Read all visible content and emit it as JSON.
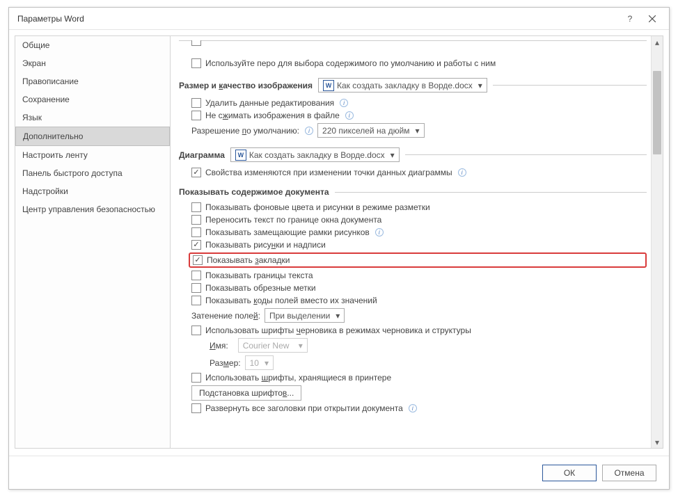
{
  "dialog": {
    "title": "Параметры Word"
  },
  "sidebar": {
    "items": [
      {
        "label": "Общие"
      },
      {
        "label": "Экран"
      },
      {
        "label": "Правописание"
      },
      {
        "label": "Сохранение"
      },
      {
        "label": "Язык"
      },
      {
        "label": "Дополнительно",
        "selected": true
      },
      {
        "label": "Настроить ленту"
      },
      {
        "label": "Панель быстрого доступа"
      },
      {
        "label": "Надстройки"
      },
      {
        "label": "Центр управления безопасностью"
      }
    ]
  },
  "top": {
    "pen_default": "Используйте перо для выбора содержимого по умолчанию и работы с ним"
  },
  "image_section": {
    "title_pre": "Размер и ",
    "title_u": "к",
    "title_post": "ачество изображения",
    "doc_dropdown": "Как создать закладку в Ворде.docx",
    "delete_edit": "Удалить данные редактирования",
    "no_compress_pre": "Не с",
    "no_compress_u": "ж",
    "no_compress_post": "имать изображения в файле",
    "resolution_label_pre": "Разрешение ",
    "resolution_label_u": "п",
    "resolution_label_post": "о умолчанию:",
    "resolution_value": "220 пикселей на дюйм"
  },
  "chart_section": {
    "title": "Диаграмма",
    "doc_dropdown": "Как создать закладку в Ворде.docx",
    "props_change": "Свойства изменяются при изменении точки данных диаграммы"
  },
  "doc_content_section": {
    "title": "Показывать содержимое документа",
    "bg_colors": "Показывать фоновые цвета и рисунки в режиме разметки",
    "wrap_text": "Переносить текст по границе окна документа",
    "placeholders": "Показывать замещающие рамки рисунков",
    "drawings_pre": "Показывать рису",
    "drawings_u": "н",
    "drawings_post": "ки и надписи",
    "bookmarks_pre": "Показывать ",
    "bookmarks_u": "з",
    "bookmarks_post": "акладки",
    "text_borders": "Показывать границы текста",
    "crop_marks": "Показывать обрезные метки",
    "field_codes_pre": "Показывать ",
    "field_codes_u": "к",
    "field_codes_post": "оды полей вместо их значений",
    "shading_label_pre": "Затенение поле",
    "shading_label_u": "й",
    "shading_label_post": ":",
    "shading_value": "При выделении",
    "draft_font_pre": "Использовать шрифты ",
    "draft_font_u": "ч",
    "draft_font_post": "ерновика в режимах черновика и структуры",
    "font_name_label_u": "И",
    "font_name_label_post": "мя:",
    "font_name_value": "Courier New",
    "font_size_label_pre": "Раз",
    "font_size_label_u": "м",
    "font_size_label_post": "ер:",
    "font_size_value": "10",
    "printer_fonts_pre": "Использовать ",
    "printer_fonts_u": "ш",
    "printer_fonts_post": "рифты, хранящиеся в принтере",
    "font_sub_btn_pre": "Подстановка шрифто",
    "font_sub_btn_u": "в",
    "font_sub_btn_post": "...",
    "expand_headers": "Развернуть все заголовки при открытии документа"
  },
  "buttons": {
    "ok": "ОК",
    "cancel": "Отмена"
  }
}
